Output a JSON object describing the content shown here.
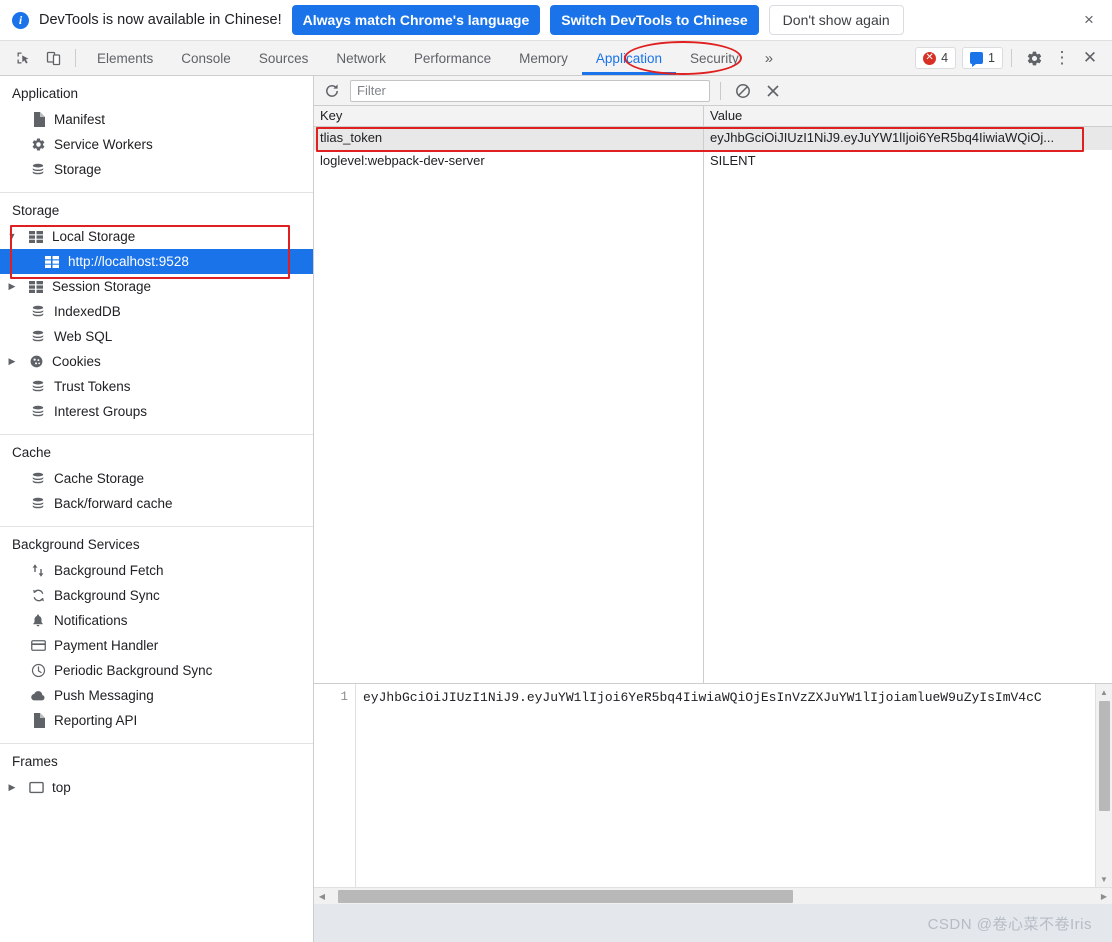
{
  "banner": {
    "info_icon": "info-icon",
    "message": "DevTools is now available in Chinese!",
    "primary_button": "Always match Chrome's language",
    "secondary_button": "Switch DevTools to Chinese",
    "tertiary_button": "Don't show again",
    "close_icon": "×"
  },
  "tabbar": {
    "inspect_icon": "inspect-element-icon",
    "device_icon": "device-toolbar-icon",
    "tabs": [
      {
        "label": "Elements",
        "selected": false
      },
      {
        "label": "Console",
        "selected": false
      },
      {
        "label": "Sources",
        "selected": false
      },
      {
        "label": "Network",
        "selected": false
      },
      {
        "label": "Performance",
        "selected": false
      },
      {
        "label": "Memory",
        "selected": false
      },
      {
        "label": "Application",
        "selected": true
      },
      {
        "label": "Security",
        "selected": false
      }
    ],
    "overflow_icon": "»",
    "error_count": "4",
    "message_count": "1",
    "settings_icon": "gear-icon",
    "menu_icon": "⋮",
    "close_icon": "✕",
    "accent_color": "#1a73e8",
    "error_color": "#d93025"
  },
  "sidebar": {
    "groups": [
      {
        "title": "Application",
        "items": [
          {
            "label": "Manifest",
            "icon": "document-icon",
            "arrow": "",
            "selected": false,
            "indent": "child"
          },
          {
            "label": "Service Workers",
            "icon": "gear-icon",
            "arrow": "",
            "selected": false,
            "indent": "child"
          },
          {
            "label": "Storage",
            "icon": "database-icon",
            "arrow": "",
            "selected": false,
            "indent": "child"
          }
        ]
      },
      {
        "title": "Storage",
        "items": [
          {
            "label": "Local Storage",
            "icon": "table-icon",
            "arrow": "▼",
            "selected": false,
            "indent": "arrow"
          },
          {
            "label": "http://localhost:9528",
            "icon": "table-icon",
            "arrow": "",
            "selected": true,
            "indent": "deep"
          },
          {
            "label": "Session Storage",
            "icon": "table-icon",
            "arrow": "▶",
            "selected": false,
            "indent": "arrow"
          },
          {
            "label": "IndexedDB",
            "icon": "database-icon",
            "arrow": "",
            "selected": false,
            "indent": "child"
          },
          {
            "label": "Web SQL",
            "icon": "database-icon",
            "arrow": "",
            "selected": false,
            "indent": "child"
          },
          {
            "label": "Cookies",
            "icon": "cookie-icon",
            "arrow": "▶",
            "selected": false,
            "indent": "arrow"
          },
          {
            "label": "Trust Tokens",
            "icon": "database-icon",
            "arrow": "",
            "selected": false,
            "indent": "child"
          },
          {
            "label": "Interest Groups",
            "icon": "database-icon",
            "arrow": "",
            "selected": false,
            "indent": "child"
          }
        ]
      },
      {
        "title": "Cache",
        "items": [
          {
            "label": "Cache Storage",
            "icon": "database-icon",
            "arrow": "",
            "selected": false,
            "indent": "child"
          },
          {
            "label": "Back/forward cache",
            "icon": "database-icon",
            "arrow": "",
            "selected": false,
            "indent": "child"
          }
        ]
      },
      {
        "title": "Background Services",
        "items": [
          {
            "label": "Background Fetch",
            "icon": "updown-arrows-icon",
            "arrow": "",
            "selected": false,
            "indent": "child"
          },
          {
            "label": "Background Sync",
            "icon": "sync-icon",
            "arrow": "",
            "selected": false,
            "indent": "child"
          },
          {
            "label": "Notifications",
            "icon": "bell-icon",
            "arrow": "",
            "selected": false,
            "indent": "child"
          },
          {
            "label": "Payment Handler",
            "icon": "credit-card-icon",
            "arrow": "",
            "selected": false,
            "indent": "child"
          },
          {
            "label": "Periodic Background Sync",
            "icon": "clock-icon",
            "arrow": "",
            "selected": false,
            "indent": "child"
          },
          {
            "label": "Push Messaging",
            "icon": "cloud-icon",
            "arrow": "",
            "selected": false,
            "indent": "child"
          },
          {
            "label": "Reporting API",
            "icon": "document-icon",
            "arrow": "",
            "selected": false,
            "indent": "child"
          }
        ]
      },
      {
        "title": "Frames",
        "items": [
          {
            "label": "top",
            "icon": "frame-icon",
            "arrow": "▶",
            "selected": false,
            "indent": "arrow"
          }
        ]
      }
    ]
  },
  "storage_toolbar": {
    "refresh_icon": "refresh-icon",
    "filter_placeholder": "Filter",
    "filter_value": "",
    "clear_icon": "clear-filter-icon",
    "delete_icon": "delete-selected-icon"
  },
  "table": {
    "columns": [
      "Key",
      "Value"
    ],
    "rows": [
      {
        "key": "tlias_token",
        "value": "eyJhbGciOiJIUzI1NiJ9.eyJuYW1lIjoi6YeR5bq4IiwiaWQiOj...",
        "selected": true
      },
      {
        "key": "loglevel:webpack-dev-server",
        "value": "SILENT",
        "selected": false
      }
    ]
  },
  "preview": {
    "line_number": "1",
    "content": "eyJhbGciOiJIUzI1NiJ9.eyJuYW1lIjoi6YeR5bq4IiwiaWQiOjEsInVzZXJuYW1lIjoiamlueW9uZyIsImV4cC"
  },
  "watermark": "CSDN @卷心菜不卷Iris",
  "annotations": {
    "color": "#e02020",
    "items": [
      {
        "name": "application-tab-highlight",
        "shape": "ellipse"
      },
      {
        "name": "local-storage-highlight",
        "shape": "rect"
      },
      {
        "name": "token-row-highlight",
        "shape": "rect"
      }
    ]
  }
}
